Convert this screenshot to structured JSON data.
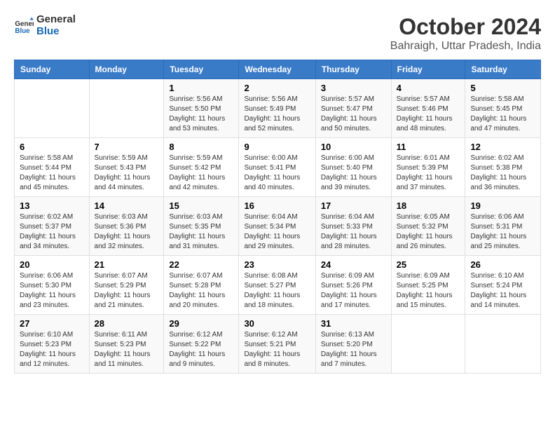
{
  "header": {
    "logo_text_general": "General",
    "logo_text_blue": "Blue",
    "title": "October 2024",
    "subtitle": "Bahraigh, Uttar Pradesh, India"
  },
  "days_of_week": [
    "Sunday",
    "Monday",
    "Tuesday",
    "Wednesday",
    "Thursday",
    "Friday",
    "Saturday"
  ],
  "weeks": [
    [
      {
        "day": "",
        "info": ""
      },
      {
        "day": "",
        "info": ""
      },
      {
        "day": "1",
        "info": "Sunrise: 5:56 AM\nSunset: 5:50 PM\nDaylight: 11 hours\nand 53 minutes."
      },
      {
        "day": "2",
        "info": "Sunrise: 5:56 AM\nSunset: 5:49 PM\nDaylight: 11 hours\nand 52 minutes."
      },
      {
        "day": "3",
        "info": "Sunrise: 5:57 AM\nSunset: 5:47 PM\nDaylight: 11 hours\nand 50 minutes."
      },
      {
        "day": "4",
        "info": "Sunrise: 5:57 AM\nSunset: 5:46 PM\nDaylight: 11 hours\nand 48 minutes."
      },
      {
        "day": "5",
        "info": "Sunrise: 5:58 AM\nSunset: 5:45 PM\nDaylight: 11 hours\nand 47 minutes."
      }
    ],
    [
      {
        "day": "6",
        "info": "Sunrise: 5:58 AM\nSunset: 5:44 PM\nDaylight: 11 hours\nand 45 minutes."
      },
      {
        "day": "7",
        "info": "Sunrise: 5:59 AM\nSunset: 5:43 PM\nDaylight: 11 hours\nand 44 minutes."
      },
      {
        "day": "8",
        "info": "Sunrise: 5:59 AM\nSunset: 5:42 PM\nDaylight: 11 hours\nand 42 minutes."
      },
      {
        "day": "9",
        "info": "Sunrise: 6:00 AM\nSunset: 5:41 PM\nDaylight: 11 hours\nand 40 minutes."
      },
      {
        "day": "10",
        "info": "Sunrise: 6:00 AM\nSunset: 5:40 PM\nDaylight: 11 hours\nand 39 minutes."
      },
      {
        "day": "11",
        "info": "Sunrise: 6:01 AM\nSunset: 5:39 PM\nDaylight: 11 hours\nand 37 minutes."
      },
      {
        "day": "12",
        "info": "Sunrise: 6:02 AM\nSunset: 5:38 PM\nDaylight: 11 hours\nand 36 minutes."
      }
    ],
    [
      {
        "day": "13",
        "info": "Sunrise: 6:02 AM\nSunset: 5:37 PM\nDaylight: 11 hours\nand 34 minutes."
      },
      {
        "day": "14",
        "info": "Sunrise: 6:03 AM\nSunset: 5:36 PM\nDaylight: 11 hours\nand 32 minutes."
      },
      {
        "day": "15",
        "info": "Sunrise: 6:03 AM\nSunset: 5:35 PM\nDaylight: 11 hours\nand 31 minutes."
      },
      {
        "day": "16",
        "info": "Sunrise: 6:04 AM\nSunset: 5:34 PM\nDaylight: 11 hours\nand 29 minutes."
      },
      {
        "day": "17",
        "info": "Sunrise: 6:04 AM\nSunset: 5:33 PM\nDaylight: 11 hours\nand 28 minutes."
      },
      {
        "day": "18",
        "info": "Sunrise: 6:05 AM\nSunset: 5:32 PM\nDaylight: 11 hours\nand 26 minutes."
      },
      {
        "day": "19",
        "info": "Sunrise: 6:06 AM\nSunset: 5:31 PM\nDaylight: 11 hours\nand 25 minutes."
      }
    ],
    [
      {
        "day": "20",
        "info": "Sunrise: 6:06 AM\nSunset: 5:30 PM\nDaylight: 11 hours\nand 23 minutes."
      },
      {
        "day": "21",
        "info": "Sunrise: 6:07 AM\nSunset: 5:29 PM\nDaylight: 11 hours\nand 21 minutes."
      },
      {
        "day": "22",
        "info": "Sunrise: 6:07 AM\nSunset: 5:28 PM\nDaylight: 11 hours\nand 20 minutes."
      },
      {
        "day": "23",
        "info": "Sunrise: 6:08 AM\nSunset: 5:27 PM\nDaylight: 11 hours\nand 18 minutes."
      },
      {
        "day": "24",
        "info": "Sunrise: 6:09 AM\nSunset: 5:26 PM\nDaylight: 11 hours\nand 17 minutes."
      },
      {
        "day": "25",
        "info": "Sunrise: 6:09 AM\nSunset: 5:25 PM\nDaylight: 11 hours\nand 15 minutes."
      },
      {
        "day": "26",
        "info": "Sunrise: 6:10 AM\nSunset: 5:24 PM\nDaylight: 11 hours\nand 14 minutes."
      }
    ],
    [
      {
        "day": "27",
        "info": "Sunrise: 6:10 AM\nSunset: 5:23 PM\nDaylight: 11 hours\nand 12 minutes."
      },
      {
        "day": "28",
        "info": "Sunrise: 6:11 AM\nSunset: 5:23 PM\nDaylight: 11 hours\nand 11 minutes."
      },
      {
        "day": "29",
        "info": "Sunrise: 6:12 AM\nSunset: 5:22 PM\nDaylight: 11 hours\nand 9 minutes."
      },
      {
        "day": "30",
        "info": "Sunrise: 6:12 AM\nSunset: 5:21 PM\nDaylight: 11 hours\nand 8 minutes."
      },
      {
        "day": "31",
        "info": "Sunrise: 6:13 AM\nSunset: 5:20 PM\nDaylight: 11 hours\nand 7 minutes."
      },
      {
        "day": "",
        "info": ""
      },
      {
        "day": "",
        "info": ""
      }
    ]
  ]
}
